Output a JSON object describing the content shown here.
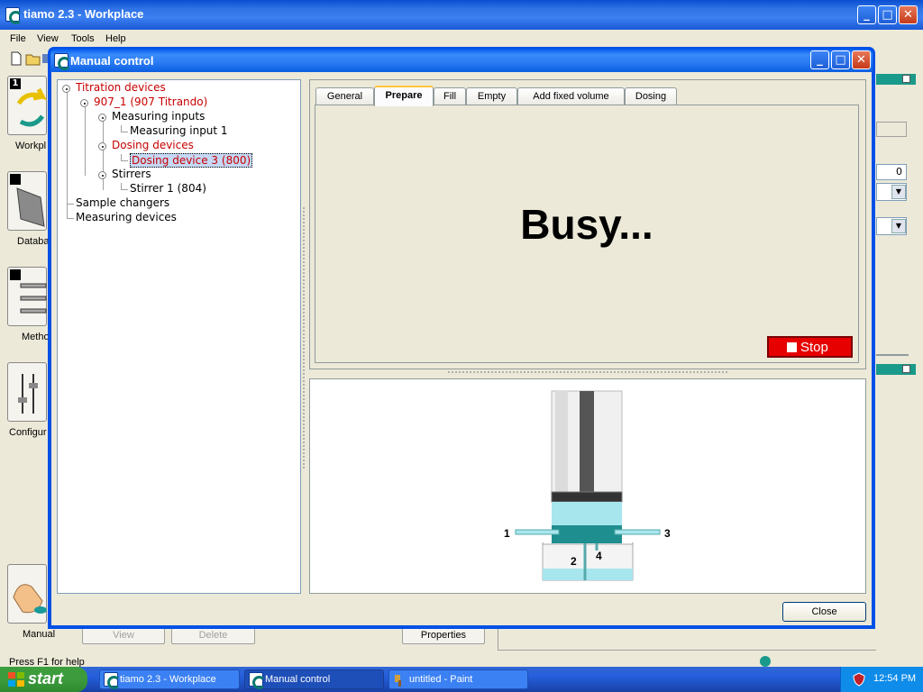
{
  "app": {
    "title": "tiamo 2.3 - Workplace",
    "menu": [
      "File",
      "View",
      "Tools",
      "Help"
    ],
    "left_items": [
      "Workpl",
      "Databa",
      "Metho",
      "Configur",
      "Manual"
    ],
    "right_field_value": "0",
    "bottom_buttons": {
      "view": "View",
      "delete": "Delete",
      "properties": "Properties"
    },
    "status_text": "Press F1 for help"
  },
  "dialog": {
    "title": "Manual control",
    "tree": {
      "root": "Titration devices",
      "device": "907_1 (907 Titrando)",
      "measuring_inputs": "Measuring inputs",
      "measuring_input_1": "Measuring input 1",
      "dosing_devices": "Dosing devices",
      "dosing_device_3": "Dosing device 3 (800)",
      "stirrers": "Stirrers",
      "stirrer_1": "Stirrer 1 (804)",
      "sample_changers": "Sample changers",
      "measuring_devices": "Measuring devices"
    },
    "tabs": [
      "General",
      "Prepare",
      "Fill",
      "Empty",
      "Add fixed volume",
      "Dosing"
    ],
    "active_tab": "Prepare",
    "busy_text": "Busy...",
    "stop_label": "Stop",
    "diagram_labels": {
      "port1": "1",
      "port2": "2",
      "port3": "3",
      "port4": "4"
    },
    "close_label": "Close"
  },
  "taskbar": {
    "start_label": "start",
    "tasks": [
      "tiamo 2.3 - Workplace",
      "Manual control",
      "untitled - Paint"
    ],
    "clock": "12:54 PM"
  },
  "colors": {
    "tree_red": "#c80000",
    "stop_red": "#e60000",
    "cylinder_teal": "#1e8e8e",
    "liquid_cyan": "#a8e6ee"
  }
}
